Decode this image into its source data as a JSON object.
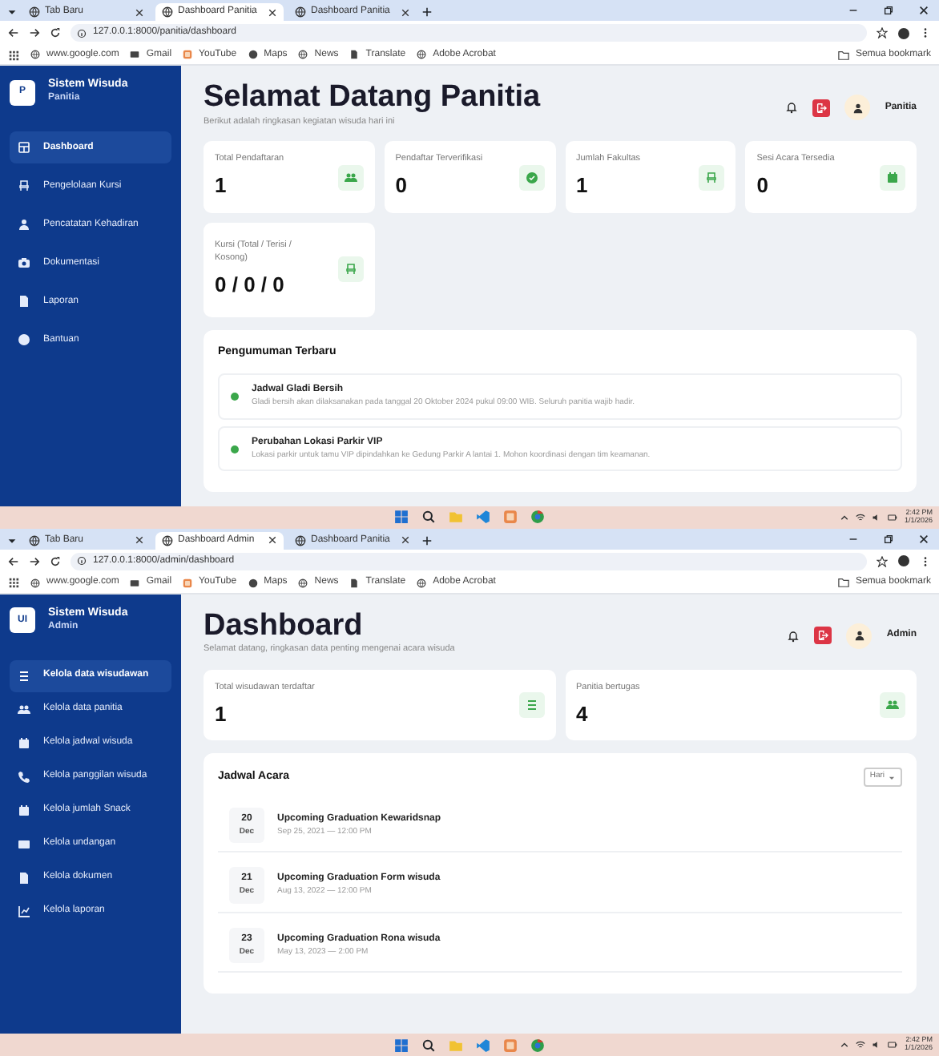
{
  "screens": [
    {
      "browser": {
        "tabs": [
          {
            "label": "Tab Baru",
            "selected": false
          },
          {
            "label": "Dashboard Panitia",
            "selected": true
          },
          {
            "label": "Dashboard Panitia",
            "selected": false
          }
        ],
        "url": "127.0.0.1:8000/panitia/dashboard",
        "bookmarks": [
          "www.google.com",
          "Gmail",
          "YouTube",
          "Maps",
          "News",
          "Translate",
          "Adobe Acrobat"
        ],
        "bookmarks_folder": "Semua bookmark"
      },
      "app": {
        "logo": "P",
        "brand_title": "Sistem Wisuda",
        "brand_subtitle": "Panitia",
        "nav": [
          {
            "label": "Dashboard",
            "selected": true
          },
          {
            "label": "Pengelolaan Kursi",
            "selected": false
          },
          {
            "label": "Pencatatan Kehadiran",
            "selected": false
          },
          {
            "label": "Dokumentasi",
            "selected": false
          },
          {
            "label": "Laporan",
            "selected": false
          },
          {
            "label": "Bantuan",
            "selected": false
          }
        ],
        "title": "Selamat Datang Panitia",
        "subtitle": "Berikut adalah ringkasan kegiatan wisuda hari ini",
        "user": "Panitia",
        "stats": [
          {
            "label": "Total Pendaftaran",
            "value": "1"
          },
          {
            "label": "Pendaftar Terverifikasi",
            "value": "0"
          },
          {
            "label": "Jumlah Fakultas",
            "value": "1"
          },
          {
            "label": "Sesi Acara Tersedia",
            "value": "0"
          },
          {
            "label": "Kursi (Total / Terisi / Kosong)",
            "value": "0 / 0 / 0"
          }
        ],
        "panel": {
          "kind": "announcements",
          "title": "Pengumuman Terbaru",
          "items": [
            {
              "title": "Jadwal Gladi Bersih",
              "text": "Gladi bersih akan dilaksanakan pada tanggal 20 Oktober 2024 pukul 09:00 WIB. Seluruh panitia wajib hadir."
            },
            {
              "title": "Perubahan Lokasi Parkir VIP",
              "text": "Lokasi parkir untuk tamu VIP dipindahkan ke Gedung Parkir A lantai 1. Mohon koordinasi dengan tim keamanan."
            }
          ]
        }
      },
      "taskbar": {
        "time": "2:42 PM",
        "date": "1/1/2026"
      }
    },
    {
      "browser": {
        "tabs": [
          {
            "label": "Tab Baru",
            "selected": false
          },
          {
            "label": "Dashboard Admin",
            "selected": true
          },
          {
            "label": "Dashboard Panitia",
            "selected": false
          }
        ],
        "url": "127.0.0.1:8000/admin/dashboard",
        "bookmarks": [
          "www.google.com",
          "Gmail",
          "YouTube",
          "Maps",
          "News",
          "Translate",
          "Adobe Acrobat"
        ],
        "bookmarks_folder": "Semua bookmark"
      },
      "app": {
        "logo": "UI",
        "brand_title": "Sistem Wisuda",
        "brand_subtitle": "Admin",
        "nav": [
          {
            "label": "Kelola data wisudawan",
            "selected": true
          },
          {
            "label": "Kelola data panitia",
            "selected": false
          },
          {
            "label": "Kelola jadwal wisuda",
            "selected": false
          },
          {
            "label": "Kelola panggilan wisuda",
            "selected": false
          },
          {
            "label": "Kelola jumlah Snack",
            "selected": false
          },
          {
            "label": "Kelola undangan",
            "selected": false
          },
          {
            "label": "Kelola dokumen",
            "selected": false
          },
          {
            "label": "Kelola laporan",
            "selected": false
          }
        ],
        "title": "Dashboard",
        "subtitle": "Selamat datang, ringkasan data penting mengenai acara wisuda",
        "user": "Admin",
        "stats": [
          {
            "label": "Total wisudawan terdaftar",
            "value": "1"
          },
          {
            "label": "Panitia bertugas",
            "value": "4"
          }
        ],
        "panel": {
          "kind": "schedule",
          "title": "Jadwal Acara",
          "filter": "Hari",
          "items": [
            {
              "day": "20",
              "month": "Dec",
              "title": "Upcoming Graduation Kewaridsnap",
              "text": "Sep 25, 2021 — 12:00 PM"
            },
            {
              "day": "21",
              "month": "Dec",
              "title": "Upcoming Graduation Form wisuda",
              "text": "Aug 13, 2022 — 12:00 PM"
            },
            {
              "day": "23",
              "month": "Dec",
              "title": "Upcoming Graduation Rona wisuda",
              "text": "May 13, 2023 — 2:00 PM"
            }
          ]
        }
      },
      "taskbar": {
        "time": "2:42 PM",
        "date": "1/1/2026"
      }
    }
  ]
}
